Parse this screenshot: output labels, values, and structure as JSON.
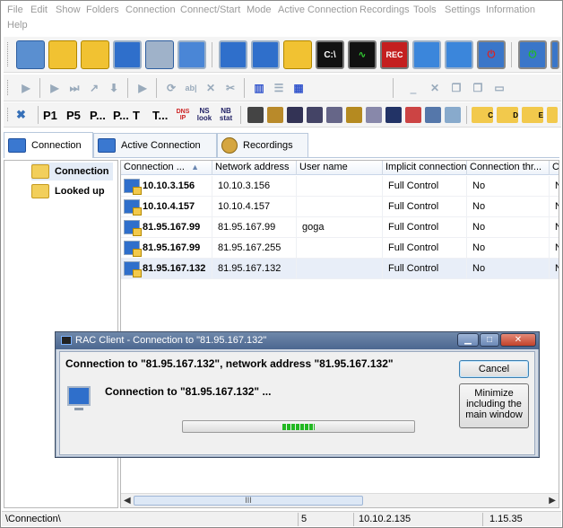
{
  "menu": {
    "items": [
      "File",
      "Edit",
      "Show",
      "Folders",
      "Connection",
      "Connect/Start",
      "Mode",
      "Active Connection",
      "Recordings",
      "Tools",
      "Settings",
      "Information",
      "Help"
    ]
  },
  "toolbar": {
    "cmd_label": "C:\\",
    "rec_label": "REC",
    "p1": "P1",
    "p5": "P5",
    "p_dots": "P...",
    "p_dots2": "P...",
    "t": "T",
    "t_dots": "T...",
    "dns": "DNS IP",
    "ns": "NS look",
    "nb": "NB stat",
    "sc": "C",
    "sd": "D",
    "se": "E"
  },
  "tabs": [
    {
      "label": "Connection"
    },
    {
      "label": "Active Connection"
    },
    {
      "label": "Recordings"
    }
  ],
  "tree": {
    "items": [
      {
        "label": "Connection"
      },
      {
        "label": "Looked up"
      }
    ]
  },
  "grid": {
    "columns": [
      "Connection ...",
      "Network address",
      "User name",
      "Implicit connection",
      "Connection thr...",
      "C"
    ],
    "sort_arrow": "▲",
    "rows": [
      {
        "connection": "10.10.3.156",
        "network": "10.10.3.156",
        "user": "",
        "implicit": "Full Control",
        "thr": "No",
        "c": "N"
      },
      {
        "connection": "10.10.4.157",
        "network": "10.10.4.157",
        "user": "",
        "implicit": "Full Control",
        "thr": "No",
        "c": "N"
      },
      {
        "connection": "81.95.167.99",
        "network": "81.95.167.99",
        "user": "goga",
        "implicit": "Full Control",
        "thr": "No",
        "c": "N"
      },
      {
        "connection": "81.95.167.99",
        "network": "81.95.167.255",
        "user": "",
        "implicit": "Full Control",
        "thr": "No",
        "c": "N"
      },
      {
        "connection": "81.95.167.132",
        "network": "81.95.167.132",
        "user": "",
        "implicit": "Full Control",
        "thr": "No",
        "c": "N"
      }
    ],
    "scroll_grip": "III"
  },
  "status": {
    "path": "\\Connection\\",
    "count": "5",
    "ip": "10.10.2.135",
    "version": "1.15.35"
  },
  "dialog": {
    "title": "RAC Client - Connection to \"81.95.167.132\"",
    "heading": "Connection to \"81.95.167.132\", network address \"81.95.167.132\"",
    "message": "Connection to \"81.95.167.132\" ...",
    "cancel_label": "Cancel",
    "minimize_label": "Minimize including the main window",
    "progress_fraction": 0.5
  },
  "colors": {
    "accent": "#2f6fcb",
    "progress": "#22b822"
  }
}
